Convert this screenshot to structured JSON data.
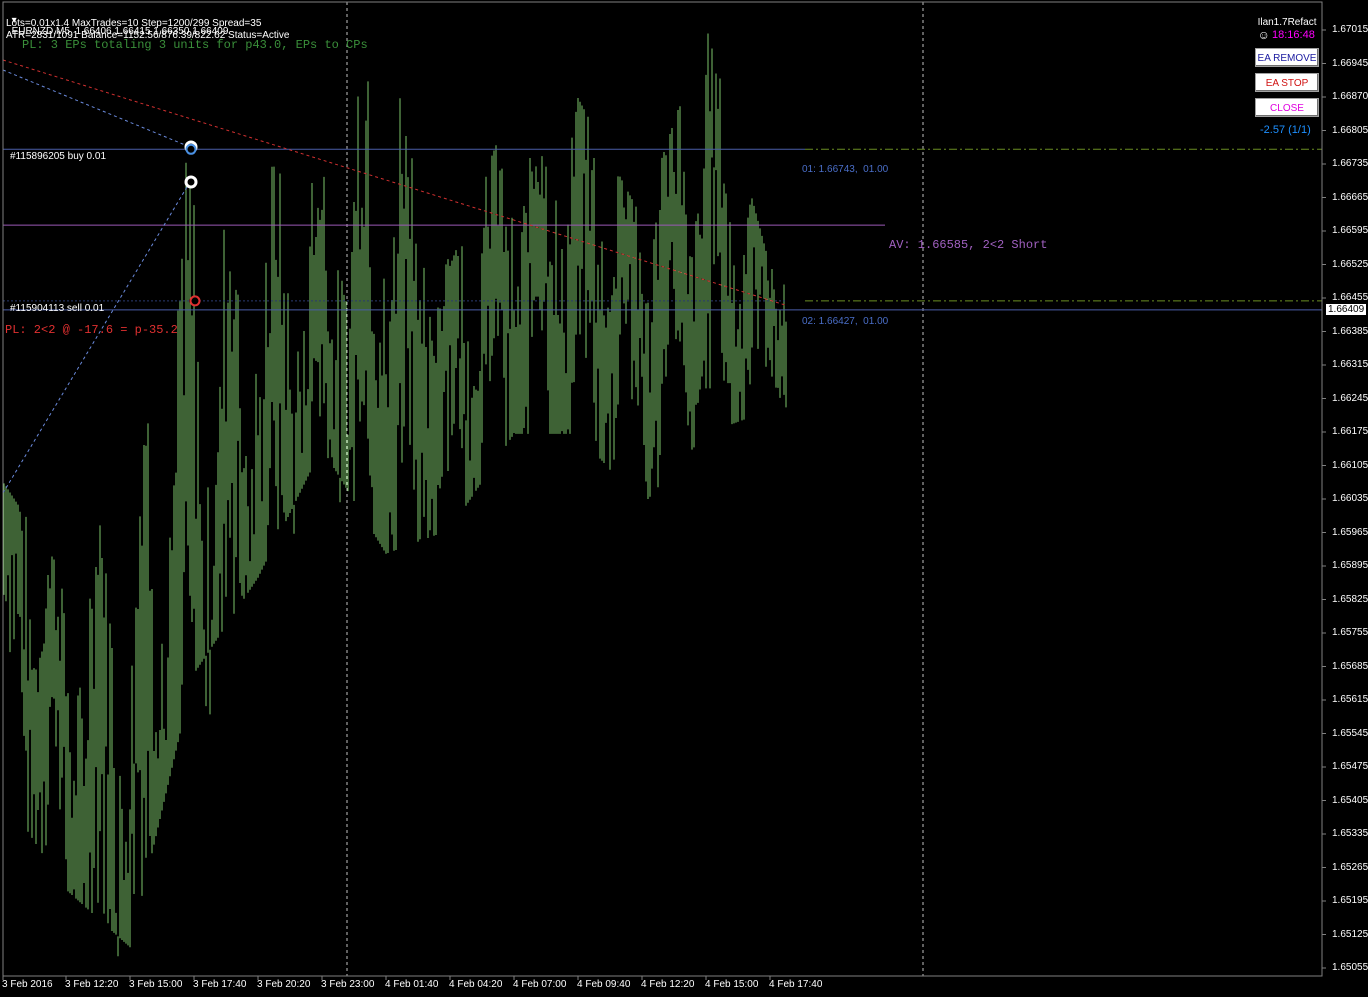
{
  "header": {
    "symbol_line": "EURNZD,M5  1.66406 1.66415 1.66350 1.66409",
    "settings_line": "Lots=0.01x1.4 MaxTrades=10 Step=1200/299 Spread=35",
    "status_line": "ATR=2831/1091 Balance=1152.56/876.39/822.62 Status=Active",
    "pl_summary": "PL: 3 EPs totaling 3 units for p43.0, EPs to CPs"
  },
  "ea": {
    "name": "Ilan1.7Refact",
    "clock": "18:16:48",
    "remove_label": "EA REMOVE",
    "stop_label": "EA STOP",
    "close_label": "CLOSE",
    "profit": "-2.57 (1/1)"
  },
  "orders": {
    "buy_label": "#115896205 buy 0.01",
    "sell_label": "#115904113 sell 0.01",
    "level1_label": "01: 1.66743,  01.00",
    "level2_label": "02: 1.66427,  01.00",
    "average_label": "AV: 1.66585, 2<2 Short",
    "pl_label": "PL: 2<2 @ -17.6 = p-35.2"
  },
  "price_axis": {
    "ticks": [
      "1.67015",
      "1.66945",
      "1.66870",
      "1.66805",
      "1.66735",
      "1.66665",
      "1.66595",
      "1.66525",
      "1.66455",
      "1.66385",
      "1.66315",
      "1.66245",
      "1.66175",
      "1.66105",
      "1.66035",
      "1.65965",
      "1.65895",
      "1.65825",
      "1.65755",
      "1.65685",
      "1.65615",
      "1.65545",
      "1.65475",
      "1.65405",
      "1.65335",
      "1.65265",
      "1.65195",
      "1.65125",
      "1.65055"
    ],
    "current_price": "1.66409"
  },
  "time_axis": {
    "ticks": [
      "3 Feb 2016",
      "3 Feb 12:20",
      "3 Feb 15:00",
      "3 Feb 17:40",
      "3 Feb 20:20",
      "3 Feb 23:00",
      "4 Feb 01:40",
      "4 Feb 04:20",
      "4 Feb 07:00",
      "4 Feb 09:40",
      "4 Feb 12:20",
      "4 Feb 15:00",
      "4 Feb 17:40"
    ]
  },
  "colors": {
    "background": "#000000",
    "bars": "#7cc46a",
    "buy_line": "#4a5ea8",
    "average_line": "#9b59b6",
    "take_profit": "#6b8e23",
    "pl_red": "#e03030",
    "clock_magenta": "#ff00ff",
    "profit_blue": "#1e90ff"
  },
  "chart_data": {
    "type": "ohlc",
    "symbol": "EURNZD",
    "timeframe": "M5",
    "ylim": [
      1.6502,
      1.6705
    ],
    "x": [
      "3 Feb 2016",
      "3 Feb 12:20",
      "3 Feb 15:00",
      "3 Feb 17:40",
      "3 Feb 20:20",
      "3 Feb 23:00",
      "4 Feb 01:40",
      "4 Feb 04:20",
      "4 Feb 07:00",
      "4 Feb 09:40",
      "4 Feb 12:20",
      "4 Feb 15:00",
      "4 Feb 17:40"
    ],
    "close_trend": [
      1.659,
      1.6545,
      1.6535,
      1.658,
      1.6605,
      1.6625,
      1.663,
      1.6625,
      1.664,
      1.6645,
      1.6638,
      1.665,
      1.66409
    ],
    "high_trend": [
      1.6605,
      1.6585,
      1.6615,
      1.6695,
      1.667,
      1.6688,
      1.6695,
      1.665,
      1.6685,
      1.6685,
      1.666,
      1.67,
      1.665
    ],
    "low_trend": [
      1.654,
      1.652,
      1.6508,
      1.6565,
      1.6585,
      1.6612,
      1.659,
      1.6595,
      1.6615,
      1.6615,
      1.66,
      1.6615,
      1.662
    ],
    "levels": {
      "buy": 1.66743,
      "sell": 1.66427,
      "average": 1.66585
    }
  }
}
